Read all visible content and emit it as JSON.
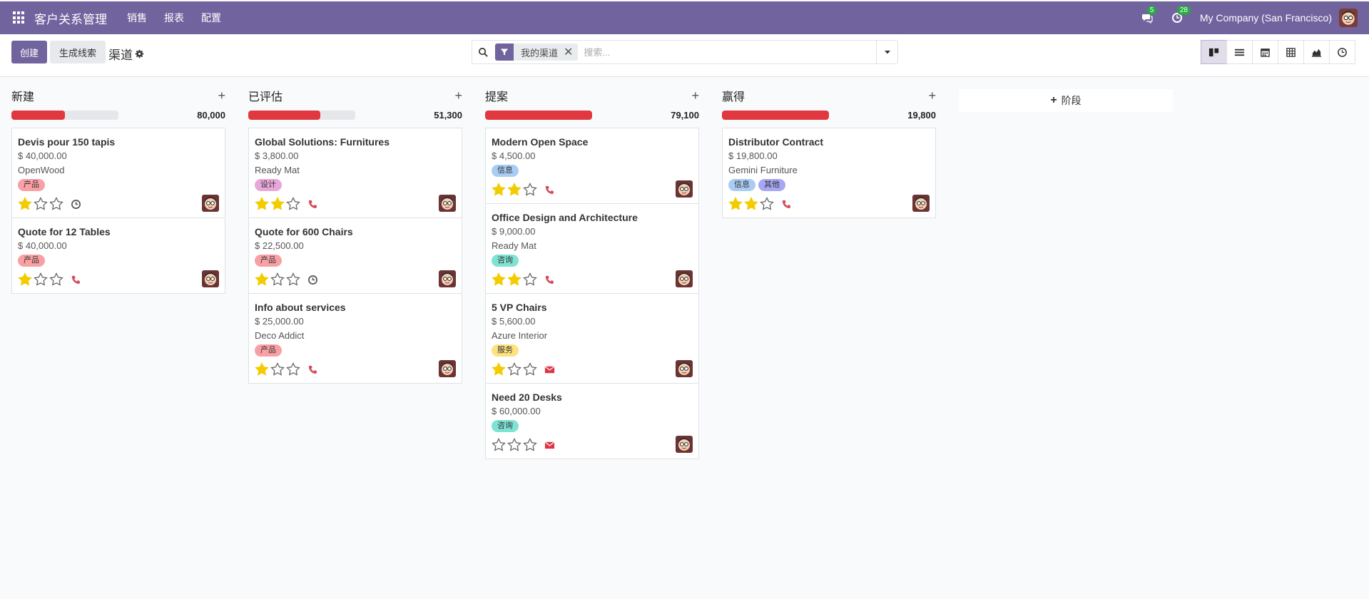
{
  "navbar": {
    "brand": "客户关系管理",
    "menus": [
      "销售",
      "报表",
      "配置"
    ],
    "messages_badge": "5",
    "activities_badge": "28",
    "company": "My Company (San Francisco)"
  },
  "control": {
    "create_label": "创建",
    "generate_leads_label": "生成线索",
    "breadcrumb": "渠道",
    "facet_label": "我的渠道",
    "facet_remove": "✕",
    "search_placeholder": "搜索..."
  },
  "add_stage_label": "阶段",
  "colors": {
    "brand": "#71639e",
    "progress": "#e0383e",
    "star_on": "#f3cc00",
    "phone": "#d44c59",
    "email": "#dc3545"
  },
  "columns": [
    {
      "title": "新建",
      "total": "80,000",
      "progress": 0.5,
      "cards": [
        {
          "title": "Devis pour 150 tapis",
          "amount": "$ 40,000.00",
          "customer": "OpenWood",
          "tags": [
            {
              "label": "产品",
              "color": "#f8a0a4"
            }
          ],
          "stars": 1,
          "activity": "clock"
        },
        {
          "title": "Quote for 12 Tables",
          "amount": "$ 40,000.00",
          "customer": "",
          "tags": [
            {
              "label": "产品",
              "color": "#f8a0a4"
            }
          ],
          "stars": 1,
          "activity": "phone"
        }
      ]
    },
    {
      "title": "已评估",
      "total": "51,300",
      "progress": 0.67,
      "cards": [
        {
          "title": "Global Solutions: Furnitures",
          "amount": "$ 3,800.00",
          "customer": "Ready Mat",
          "tags": [
            {
              "label": "设计",
              "color": "#e8a7da"
            }
          ],
          "stars": 2,
          "activity": "phone"
        },
        {
          "title": "Quote for 600 Chairs",
          "amount": "$ 22,500.00",
          "customer": "",
          "tags": [
            {
              "label": "产品",
              "color": "#f8a0a4"
            }
          ],
          "stars": 1,
          "activity": "clock"
        },
        {
          "title": "Info about services",
          "amount": "$ 25,000.00",
          "customer": "Deco Addict",
          "tags": [
            {
              "label": "产品",
              "color": "#f8a0a4"
            }
          ],
          "stars": 1,
          "activity": "phone"
        }
      ]
    },
    {
      "title": "提案",
      "total": "79,100",
      "progress": 1.0,
      "cards": [
        {
          "title": "Modern Open Space",
          "amount": "$ 4,500.00",
          "customer": "",
          "tags": [
            {
              "label": "信息",
              "color": "#a8ccf3"
            }
          ],
          "stars": 2,
          "activity": "phone"
        },
        {
          "title": "Office Design and Architecture",
          "amount": "$ 9,000.00",
          "customer": "Ready Mat",
          "tags": [
            {
              "label": "咨询",
              "color": "#7ee3d3"
            }
          ],
          "stars": 2,
          "activity": "phone"
        },
        {
          "title": "5 VP Chairs",
          "amount": "$ 5,600.00",
          "customer": "Azure Interior",
          "tags": [
            {
              "label": "服务",
              "color": "#fde27f"
            }
          ],
          "stars": 1,
          "activity": "email"
        },
        {
          "title": "Need 20 Desks",
          "amount": "$ 60,000.00",
          "customer": "",
          "tags": [
            {
              "label": "咨询",
              "color": "#7ee3d3"
            }
          ],
          "stars": 0,
          "activity": "email"
        }
      ]
    },
    {
      "title": "赢得",
      "total": "19,800",
      "progress": 1.0,
      "cards": [
        {
          "title": "Distributor Contract",
          "amount": "$ 19,800.00",
          "customer": "Gemini Furniture",
          "tags": [
            {
              "label": "信息",
              "color": "#a8ccf3"
            },
            {
              "label": "其他",
              "color": "#a7a7f5"
            }
          ],
          "stars": 2,
          "activity": "phone"
        }
      ]
    }
  ]
}
